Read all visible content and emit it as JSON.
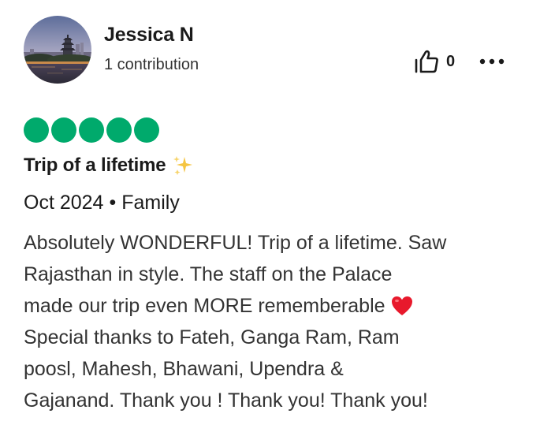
{
  "reviewer": {
    "name": "Jessica N",
    "contributions": "1 contribution"
  },
  "actions": {
    "helpful_count": "0",
    "helpful_icon": "thumbs-up-icon",
    "more_icon": "more-options-icon"
  },
  "review": {
    "rating": 5,
    "title": "Trip of a lifetime",
    "title_emoji": "sparkles-icon",
    "date": "Oct 2024",
    "separator": "•",
    "trip_type": "Family",
    "body_lines": [
      "Absolutely WONDERFUL! Trip of a lifetime. Saw",
      "Rajasthan in style. The staff on the Palace",
      "made our trip even MORE rememberable",
      "Special thanks to Fateh, Ganga Ram, Ram",
      "poosl, Mahesh, Bhawani, Upendra &",
      "Gajanand. Thank you ! Thank you! Thank you!"
    ],
    "body_emoji": "red-heart-icon"
  },
  "colors": {
    "rating_bubble": "#00aa6c",
    "text_primary": "#1a1a1a",
    "text_secondary": "#333333",
    "heart": "#e8192c",
    "sparkle": "#f5c542"
  }
}
